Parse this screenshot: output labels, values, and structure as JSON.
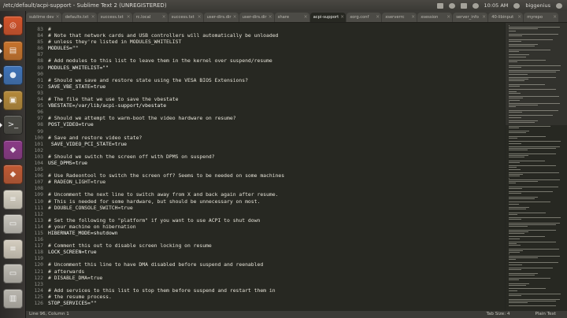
{
  "window": {
    "title": "/etc/default/acpi-support - Sublime Text 2 (UNREGISTERED)"
  },
  "indicators": {
    "clock": "10:05 AM",
    "user": "biggenius"
  },
  "launcher": [
    {
      "name": "ubuntu-home",
      "icon": "ubuntu-logo-icon",
      "color": "#d4542b"
    },
    {
      "name": "files",
      "icon": "folder-icon",
      "color": "#c8742c"
    },
    {
      "name": "firefox",
      "icon": "firefox-icon",
      "color": "#3f74b9"
    },
    {
      "name": "app-3",
      "icon": "package-icon",
      "color": "#b58a3a"
    },
    {
      "name": "terminal",
      "icon": "terminal-icon",
      "color": "#4a4a44"
    },
    {
      "name": "app-5",
      "icon": "app-icon",
      "color": "#8b3a88"
    },
    {
      "name": "app-6",
      "icon": "app-icon",
      "color": "#c05a34"
    },
    {
      "name": "document",
      "icon": "document-icon",
      "color": "#d9d4c6"
    },
    {
      "name": "drive-1",
      "icon": "drive-icon",
      "color": "#c8c5bd"
    },
    {
      "name": "document-2",
      "icon": "document-icon",
      "color": "#d5cec0"
    },
    {
      "name": "drive-2",
      "icon": "drive-icon",
      "color": "#bebbb3"
    },
    {
      "name": "trash",
      "icon": "trash-icon",
      "color": "#b9b6ae"
    }
  ],
  "tabs": [
    {
      "label": "sublime dev"
    },
    {
      "label": "defaults.txt"
    },
    {
      "label": "success.txt"
    },
    {
      "label": "rc.local"
    },
    {
      "label": "success.txt"
    },
    {
      "label": "user-dirs.dir"
    },
    {
      "label": "user-dirs.dir"
    },
    {
      "label": "share"
    },
    {
      "label": "acpi-support",
      "active": true
    },
    {
      "label": "xorg.conf"
    },
    {
      "label": "xserverrc"
    },
    {
      "label": "xsession"
    },
    {
      "label": "server_info"
    },
    {
      "label": "40-libinput"
    },
    {
      "label": "myrepo"
    }
  ],
  "code_lines": [
    {
      "n": "83",
      "t": "#"
    },
    {
      "n": "84",
      "t": "# Note that network cards and USB controllers will automatically be unloaded"
    },
    {
      "n": "85",
      "t": "# unless they're listed in MODULES_WHITELIST"
    },
    {
      "n": "86",
      "t": "MODULES=\"\""
    },
    {
      "n": "87",
      "t": ""
    },
    {
      "n": "88",
      "t": "# Add modules to this list to leave them in the kernel over suspend/resume"
    },
    {
      "n": "89",
      "t": "MODULES_WHITELIST=\"\""
    },
    {
      "n": "90",
      "t": ""
    },
    {
      "n": "91",
      "t": "# Should we save and restore state using the VESA BIOS Extensions?"
    },
    {
      "n": "92",
      "t": "SAVE_VBE_STATE=true"
    },
    {
      "n": "93",
      "t": ""
    },
    {
      "n": "94",
      "t": "# The file that we use to save the vbestate"
    },
    {
      "n": "95",
      "t": "VBESTATE=/var/lib/acpi-support/vbestate"
    },
    {
      "n": "96",
      "t": ""
    },
    {
      "n": "97",
      "t": "# Should we attempt to warm-boot the video hardware on resume?"
    },
    {
      "n": "98",
      "t": "POST_VIDEO=true"
    },
    {
      "n": "99",
      "t": ""
    },
    {
      "n": "100",
      "t": "# Save and restore video state?"
    },
    {
      "n": "101",
      "t": " SAVE_VIDEO_PCI_STATE=true"
    },
    {
      "n": "102",
      "t": ""
    },
    {
      "n": "103",
      "t": "# Should we switch the screen off with DPMS on suspend?"
    },
    {
      "n": "104",
      "t": "USE_DPMS=true"
    },
    {
      "n": "105",
      "t": ""
    },
    {
      "n": "106",
      "t": "# Use Radeontool to switch the screen off? Seems to be needed on some machines"
    },
    {
      "n": "107",
      "t": "# RADEON_LIGHT=true"
    },
    {
      "n": "108",
      "t": ""
    },
    {
      "n": "109",
      "t": "# Uncomment the next line to switch away from X and back again after resume."
    },
    {
      "n": "110",
      "t": "# This is needed for some hardware, but should be unnecessary on most."
    },
    {
      "n": "111",
      "t": "# DOUBLE_CONSOLE_SWITCH=true"
    },
    {
      "n": "112",
      "t": ""
    },
    {
      "n": "113",
      "t": "# Set the following to \"platform\" if you want to use ACPI to shut down"
    },
    {
      "n": "114",
      "t": "# your machine on hibernation"
    },
    {
      "n": "115",
      "t": "HIBERNATE_MODE=shutdown"
    },
    {
      "n": "116",
      "t": ""
    },
    {
      "n": "117",
      "t": "# Comment this out to disable screen locking on resume"
    },
    {
      "n": "118",
      "t": "LOCK_SCREEN=true"
    },
    {
      "n": "119",
      "t": ""
    },
    {
      "n": "120",
      "t": "# Uncomment this line to have DMA disabled before suspend and reenabled"
    },
    {
      "n": "121",
      "t": "# afterwards"
    },
    {
      "n": "122",
      "t": "# DISABLE_DMA=true"
    },
    {
      "n": "123",
      "t": ""
    },
    {
      "n": "124",
      "t": "# Add services to this list to stop them before suspend and restart them in"
    },
    {
      "n": "125",
      "t": "# the resume process."
    },
    {
      "n": "126",
      "t": "STOP_SERVICES=\"\""
    }
  ],
  "status": {
    "position": "Line 96, Column 1",
    "tab_size": "Tab Size: 4",
    "syntax": "Plain Text"
  }
}
